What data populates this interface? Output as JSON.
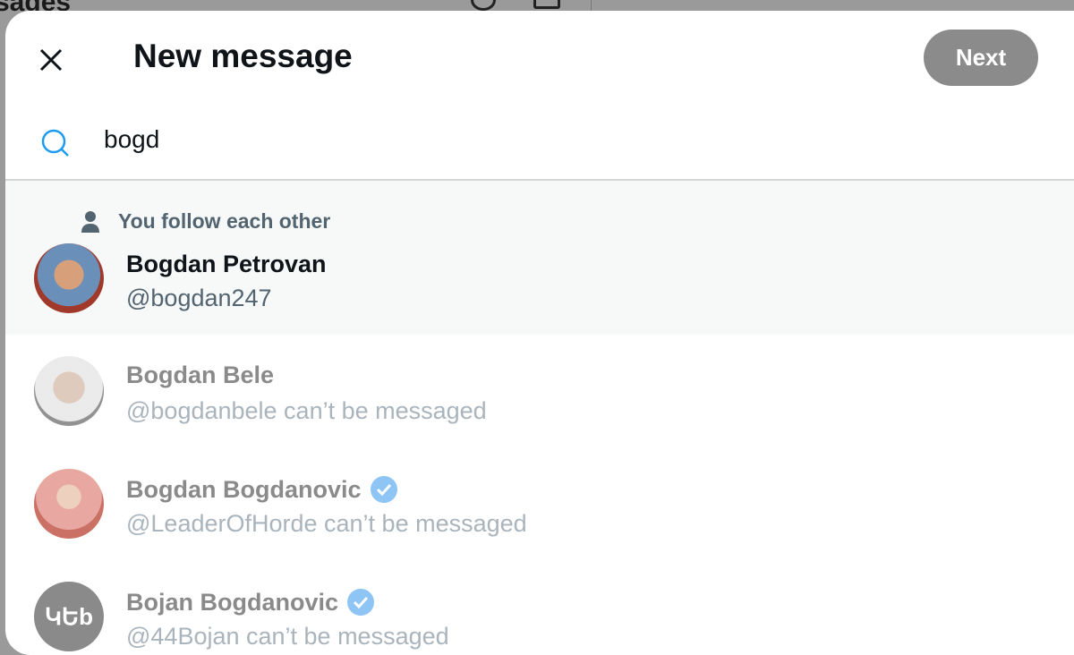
{
  "background": {
    "title": "sages"
  },
  "modal": {
    "title": "New message",
    "next_label": "Next",
    "search": {
      "value": "bogd"
    },
    "results": [
      {
        "context": "You follow each other",
        "name": "Bogdan Petrovan",
        "handle": "@bogdan247",
        "verified": false,
        "avatar_color": "#a05a3a"
      },
      {
        "name": "Bogdan Bele",
        "handle": "@bogdanbele can’t be messaged",
        "verified": false,
        "avatar_color": "#b8b0a8"
      },
      {
        "name": "Bogdan Bogdanovic",
        "handle": "@LeaderOfHorde can’t be messaged",
        "verified": true,
        "avatar_color": "#e39a90"
      },
      {
        "name": "Bojan Bogdanovic",
        "handle": "@44Bojan can’t be messaged",
        "verified": true,
        "avatar_color": "#8a8a8a",
        "avatar_text": "ԿԵb"
      }
    ]
  },
  "colors": {
    "accent": "#1d9bf0",
    "verified": "#8ec5f5"
  }
}
